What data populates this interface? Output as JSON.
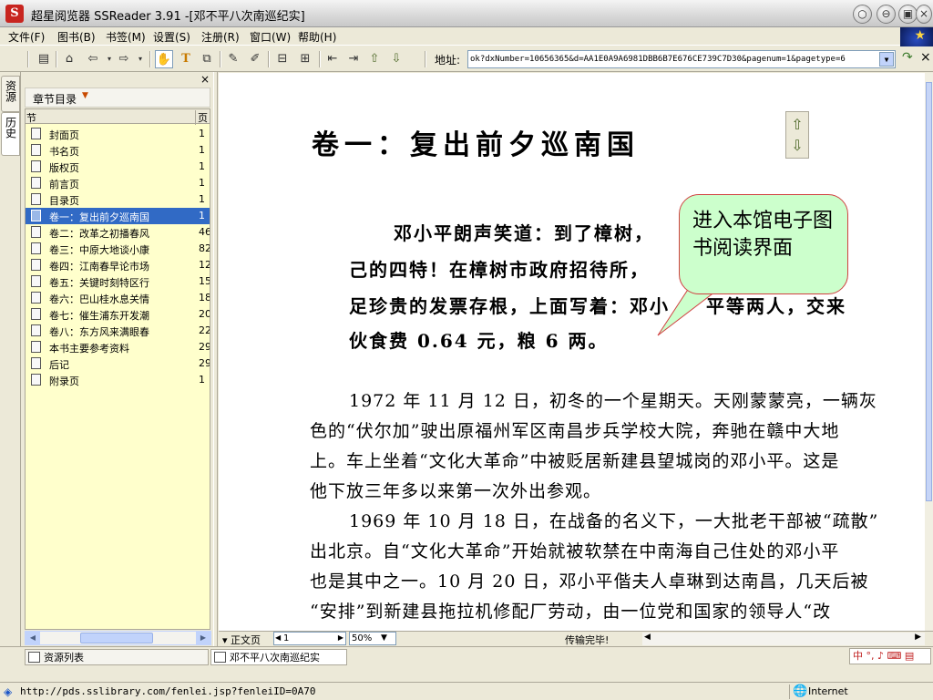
{
  "window": {
    "title": "超星阅览器 SSReader 3.91 -[邓不平八次南巡纪实]",
    "controls": [
      "minimize",
      "restore",
      "maximize",
      "close"
    ]
  },
  "menubar": {
    "items": [
      "文件(F)",
      "图书(B)",
      "书签(M)",
      "设置(S)",
      "注册(R)",
      "窗口(W)",
      "帮助(H)"
    ]
  },
  "toolbar": {
    "address_label": "地址:",
    "address_value": "ok?dxNumber=10656365&d=AA1E0A9A6981DBB6B7E676CE739C7D30&pagenum=1&pagetype=6"
  },
  "side_tabs": [
    "资源",
    "历史"
  ],
  "toc": {
    "title": "章节目录",
    "col_section": "节",
    "col_page": "页",
    "rows": [
      {
        "label": "封面页",
        "page": "1",
        "selected": false
      },
      {
        "label": "书名页",
        "page": "1",
        "selected": false
      },
      {
        "label": "版权页",
        "page": "1",
        "selected": false
      },
      {
        "label": "前言页",
        "page": "1",
        "selected": false
      },
      {
        "label": "目录页",
        "page": "1",
        "selected": false
      },
      {
        "label": "卷一：复出前夕巡南国",
        "page": "1",
        "selected": true
      },
      {
        "label": "卷二：改革之初播春风",
        "page": "46",
        "selected": false
      },
      {
        "label": "卷三：中原大地谈小康",
        "page": "82",
        "selected": false
      },
      {
        "label": "卷四：江南春早论市场",
        "page": "12",
        "selected": false
      },
      {
        "label": "卷五：关键时刻特区行",
        "page": "15",
        "selected": false
      },
      {
        "label": "卷六：巴山桂水息关情",
        "page": "18",
        "selected": false
      },
      {
        "label": "卷七：催生浦东开发潮",
        "page": "20",
        "selected": false
      },
      {
        "label": "卷八：东方风来满眼春",
        "page": "22",
        "selected": false
      },
      {
        "label": "本书主要参考资料",
        "page": "29",
        "selected": false
      },
      {
        "label": "后记",
        "page": "29",
        "selected": false
      },
      {
        "label": "附录页",
        "page": "1",
        "selected": false
      }
    ]
  },
  "document": {
    "heading": "卷一：复出前夕巡南国",
    "quote_lines": [
      "邓小平朗声笑道：到了樟树，",
      "己的四特！在樟树市政府招待所，",
      "足珍贵的发票存根，上面写着：邓小",
      "伙食费 0.64 元，粮 6 两。"
    ],
    "quote_tail_line3": "平等两人，交来",
    "body_lines": [
      "1972 年 11 月 12 日，初冬的一个星期天。天刚蒙蒙亮，一辆灰",
      "色的“伏尔加”驶出原福州军区南昌步兵学校大院，奔驰在赣中大地",
      "上。车上坐着“文化大革命”中被贬居新建县望城岗的邓小平。这是",
      "他下放三年多以来第一次外出参观。",
      "1969 年 10 月 18 日，在战备的名义下，一大批老干部被“疏散”",
      "出北京。自“文化大革命”开始就被软禁在中南海自己住处的邓小平",
      "也是其中之一。10 月 20 日，邓小平偕夫人卓琳到达南昌，几天后被",
      "“安排”到新建县拖拉机修配厂劳动，由一位党和国家的领导人“改"
    ],
    "callout": "进入本馆电子图书阅读界面"
  },
  "statusbar": {
    "view_mode": "正文页",
    "page": "1",
    "zoom": "50%",
    "transfer_status": "传输完毕!"
  },
  "task_tabs": [
    "资源列表",
    "邓不平八次南巡纪实"
  ],
  "ie_status": {
    "url": "http://pds.sslibrary.com/fenlei.jsp?fenleiID=0A70",
    "zone": "Internet"
  },
  "colors": {
    "selection": "#316ac5",
    "toc_background": "#ffffcc",
    "callout_fill": "#ccffcc",
    "callout_border": "#d04040",
    "app_red": "#c8251f"
  }
}
